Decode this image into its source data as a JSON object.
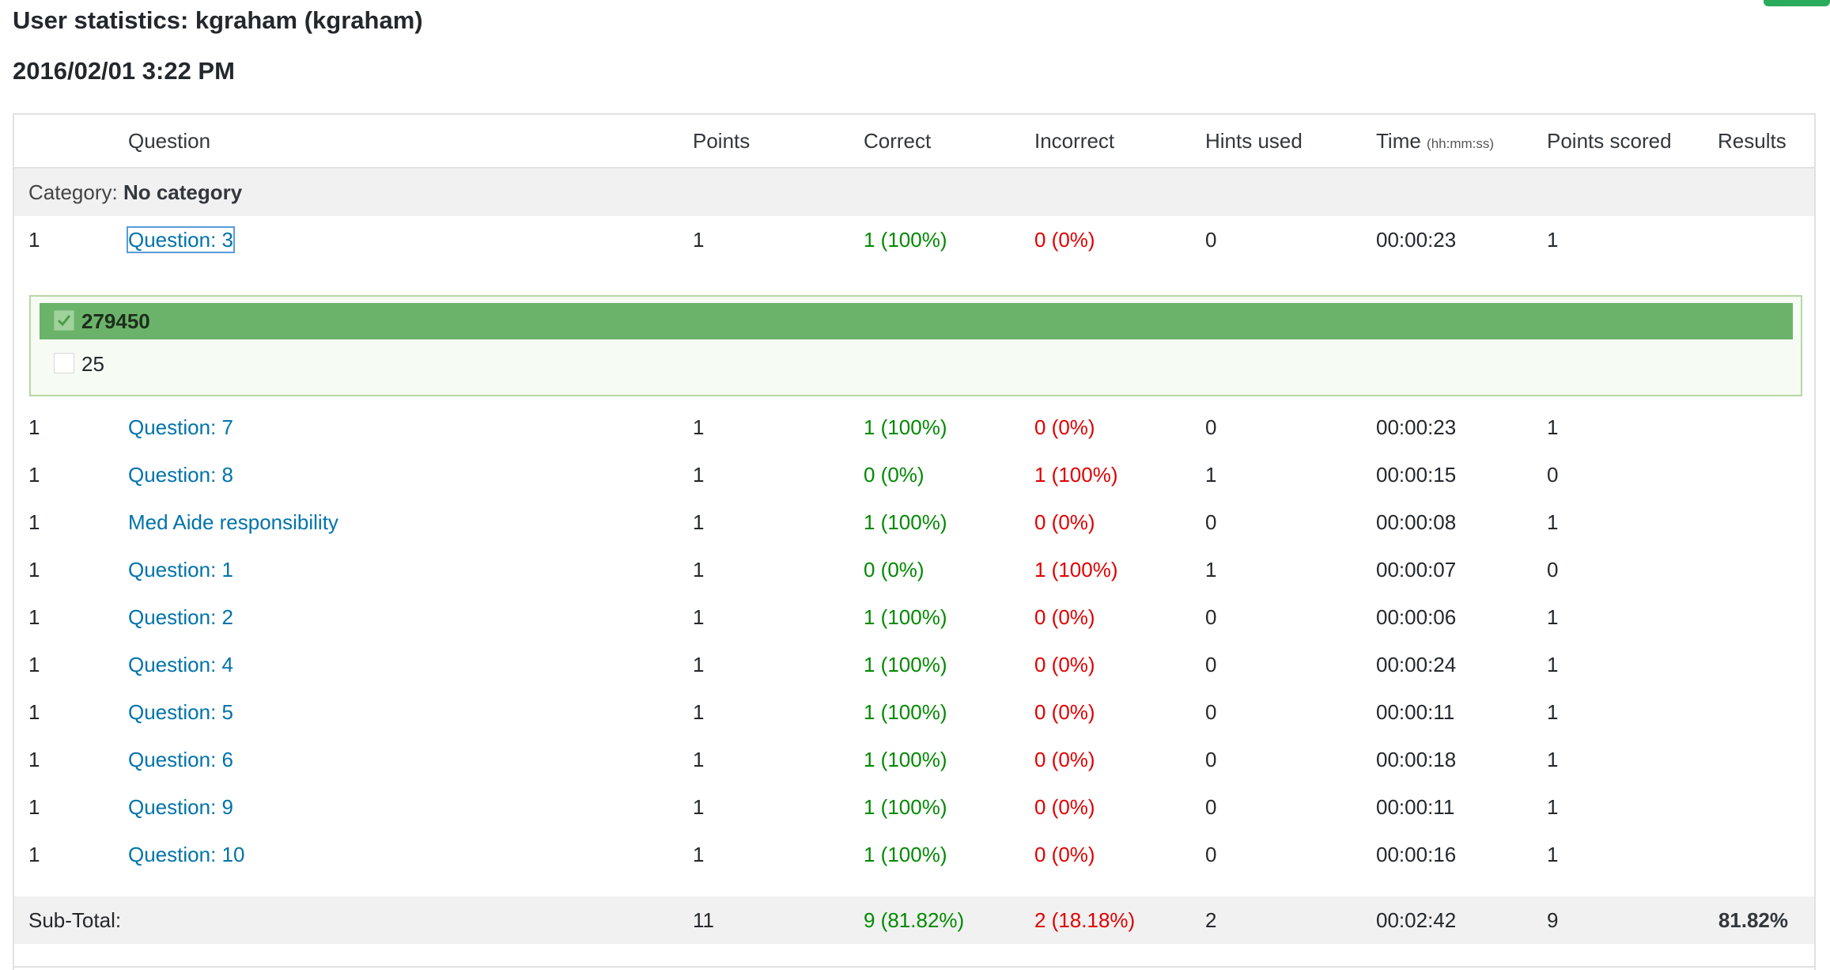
{
  "title": "User statistics: kgraham (kgraham)",
  "date": "2016/02/01 3:22 PM",
  "headers": {
    "question": "Question",
    "points": "Points",
    "correct": "Correct",
    "incorrect": "Incorrect",
    "hints": "Hints used",
    "time": "Time",
    "time_format": "(hh:mm:ss)",
    "points_scored": "Points scored",
    "results": "Results"
  },
  "category": {
    "label": "Category:",
    "name": "No category"
  },
  "rows": [
    {
      "num": "1",
      "question": "Question: 3",
      "points": "1",
      "correct": "1 (100%)",
      "incorrect": "0 (0%)",
      "hints": "0",
      "time": "00:00:23",
      "scored": "1"
    },
    {
      "num": "1",
      "question": "Question: 7",
      "points": "1",
      "correct": "1 (100%)",
      "incorrect": "0 (0%)",
      "hints": "0",
      "time": "00:00:23",
      "scored": "1"
    },
    {
      "num": "1",
      "question": "Question: 8",
      "points": "1",
      "correct": "0 (0%)",
      "incorrect": "1 (100%)",
      "hints": "1",
      "time": "00:00:15",
      "scored": "0"
    },
    {
      "num": "1",
      "question": "Med Aide responsibility",
      "points": "1",
      "correct": "1 (100%)",
      "incorrect": "0 (0%)",
      "hints": "0",
      "time": "00:00:08",
      "scored": "1"
    },
    {
      "num": "1",
      "question": "Question: 1",
      "points": "1",
      "correct": "0 (0%)",
      "incorrect": "1 (100%)",
      "hints": "1",
      "time": "00:00:07",
      "scored": "0"
    },
    {
      "num": "1",
      "question": "Question: 2",
      "points": "1",
      "correct": "1 (100%)",
      "incorrect": "0 (0%)",
      "hints": "0",
      "time": "00:00:06",
      "scored": "1"
    },
    {
      "num": "1",
      "question": "Question: 4",
      "points": "1",
      "correct": "1 (100%)",
      "incorrect": "0 (0%)",
      "hints": "0",
      "time": "00:00:24",
      "scored": "1"
    },
    {
      "num": "1",
      "question": "Question: 5",
      "points": "1",
      "correct": "1 (100%)",
      "incorrect": "0 (0%)",
      "hints": "0",
      "time": "00:00:11",
      "scored": "1"
    },
    {
      "num": "1",
      "question": "Question: 6",
      "points": "1",
      "correct": "1 (100%)",
      "incorrect": "0 (0%)",
      "hints": "0",
      "time": "00:00:18",
      "scored": "1"
    },
    {
      "num": "1",
      "question": "Question: 9",
      "points": "1",
      "correct": "1 (100%)",
      "incorrect": "0 (0%)",
      "hints": "0",
      "time": "00:00:11",
      "scored": "1"
    },
    {
      "num": "1",
      "question": "Question: 10",
      "points": "1",
      "correct": "1 (100%)",
      "incorrect": "0 (0%)",
      "hints": "0",
      "time": "00:00:16",
      "scored": "1"
    }
  ],
  "answers": [
    {
      "label": "279450",
      "checked": true
    },
    {
      "label": "25",
      "checked": false
    }
  ],
  "subtotal": {
    "label": "Sub-Total:",
    "points": "11",
    "correct": "9 (81.82%)",
    "incorrect": "2 (18.18%)",
    "hints": "2",
    "time": "00:02:42",
    "scored": "9",
    "result": "81.82%"
  },
  "colors": {
    "correct": "#008a00",
    "incorrect": "#e00000",
    "link": "#0073aa",
    "answer_highlight": "#6bb36a"
  }
}
